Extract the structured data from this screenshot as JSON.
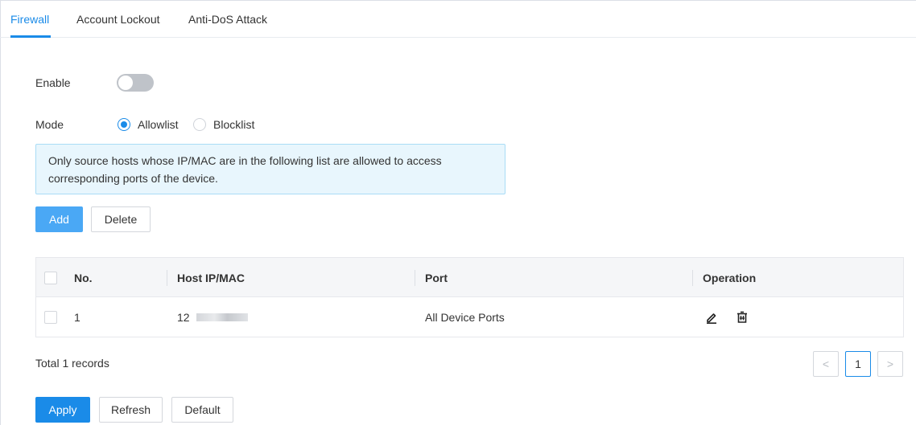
{
  "tabs": [
    {
      "label": "Firewall",
      "active": true
    },
    {
      "label": "Account Lockout",
      "active": false
    },
    {
      "label": "Anti-DoS Attack",
      "active": false
    }
  ],
  "form": {
    "enable_label": "Enable",
    "enable_on": false,
    "mode_label": "Mode",
    "mode_options": [
      "Allowlist",
      "Blocklist"
    ],
    "mode_selected": "Allowlist"
  },
  "notice": "Only source hosts whose IP/MAC are in the following list are allowed to access corresponding ports of the device.",
  "actions": {
    "add_label": "Add",
    "delete_label": "Delete"
  },
  "table": {
    "columns": [
      "No.",
      "Host IP/MAC",
      "Port",
      "Operation"
    ],
    "rows": [
      {
        "no": "1",
        "host": "12",
        "port": "All Device Ports"
      }
    ],
    "row_icons": [
      "edit-icon",
      "delete-icon"
    ]
  },
  "footer": {
    "total_text": "Total 1 records",
    "current_page": "1",
    "prev_glyph": "<",
    "next_glyph": ">"
  },
  "buttons": {
    "apply_label": "Apply",
    "refresh_label": "Refresh",
    "default_label": "Default"
  },
  "colors": {
    "accent": "#1a8be8",
    "notice_bg": "#e8f6fd",
    "notice_border": "#a9dcf6"
  }
}
